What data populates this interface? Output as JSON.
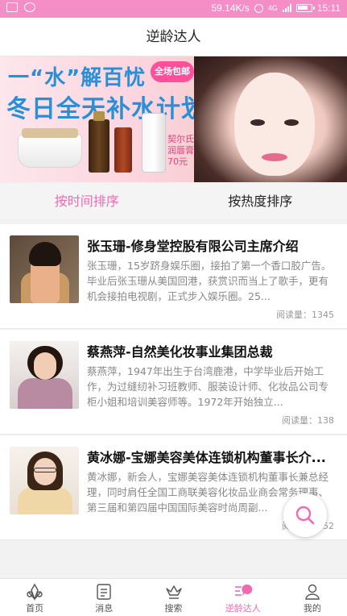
{
  "statusbar": {
    "speed": "59.14K/s",
    "network": "4G",
    "time": "15:11",
    "battery_level": 0.8
  },
  "header": {
    "title": "逆龄达人"
  },
  "banner": {
    "line1": "一“水”解百忧",
    "line2": "冬日全天补水计划",
    "badge": "全场包邮",
    "product_label": "契尔氏\n润唇膏",
    "price": "70元"
  },
  "sort_tabs": [
    {
      "label": "按时间排序",
      "active": true
    },
    {
      "label": "按热度排序",
      "active": false
    }
  ],
  "articles": [
    {
      "title": "张玉珊-修身堂控股有限公司主席介绍",
      "desc": "张玉珊，15岁跻身娱乐圈，接拍了第一个香口胶广告。毕业后张玉珊从美国回港，获赏识而当上了歌手，更有机会接拍电视剧，正式步入娱乐圈。25...",
      "read_label": "阅读量：",
      "read_count": "1345"
    },
    {
      "title": "蔡燕萍-自然美化妆事业集团总裁",
      "desc": "蔡燕萍，1947年出生于台湾鹿港，中学毕业后开始工作，为过缝纫补习班教师、服装设计师、化妆品公司专柜小姐和培训美容师等。1972年开始独立...",
      "read_label": "阅读量：",
      "read_count": "138"
    },
    {
      "title": "黄冰娜-宝娜美容美体连锁机构董事长介...",
      "desc": "黄冰娜，新会人，宝娜美容美体连锁机构董事长兼总经理，同时肩任全国工商联美容化妆品业商会常务理事、第三届和第四届中国国际美容时尚周副...",
      "read_label": "阅读量：",
      "read_count": "152"
    }
  ],
  "tabbar": [
    {
      "label": "首页",
      "icon": "home-icon",
      "active": false
    },
    {
      "label": "消息",
      "icon": "message-icon",
      "active": false
    },
    {
      "label": "搜索",
      "icon": "crown-icon",
      "active": false
    },
    {
      "label": "逆龄达人",
      "icon": "chat-icon",
      "active": true
    },
    {
      "label": "我的",
      "icon": "user-icon",
      "active": false
    }
  ],
  "colors": {
    "accent": "#f06ab2",
    "statusbar": "#f58dc6",
    "banner_text": "#2a8fd6"
  }
}
